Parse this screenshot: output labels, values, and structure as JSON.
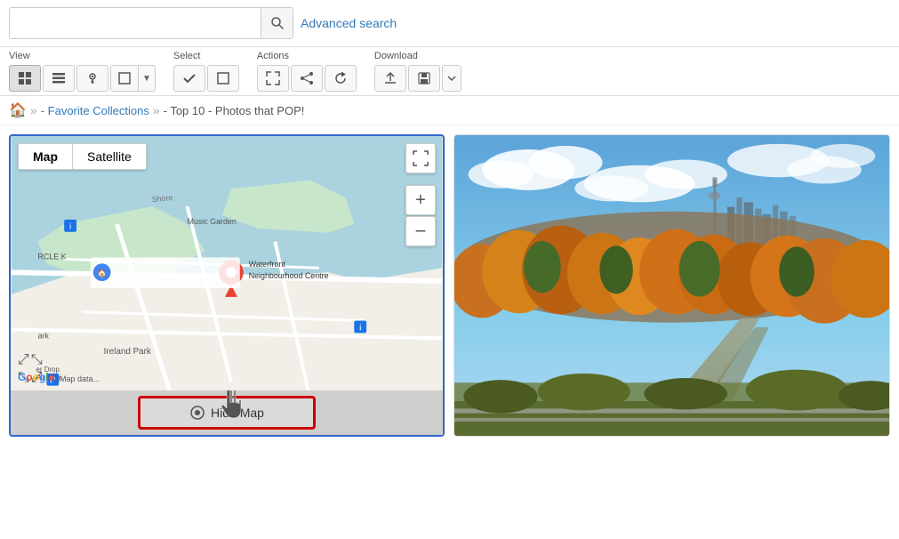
{
  "search": {
    "placeholder": "",
    "value": "",
    "advanced_link": "Advanced search"
  },
  "toolbar": {
    "view_label": "View",
    "select_label": "Select",
    "actions_label": "Actions",
    "download_label": "Download",
    "view_buttons": [
      {
        "id": "grid",
        "icon": "⊞",
        "active": true
      },
      {
        "id": "list",
        "icon": "☰",
        "active": false
      },
      {
        "id": "map",
        "icon": "📍",
        "active": false
      }
    ],
    "select_buttons": [
      {
        "id": "check",
        "icon": "✓",
        "active": false
      },
      {
        "id": "square",
        "icon": "□",
        "active": false
      }
    ],
    "actions_buttons": [
      {
        "id": "expand",
        "icon": "⤢",
        "active": false
      },
      {
        "id": "share",
        "icon": "≺",
        "active": false
      },
      {
        "id": "refresh",
        "icon": "↻",
        "active": false
      }
    ],
    "download_buttons": [
      {
        "id": "upload",
        "icon": "⬆",
        "active": false
      },
      {
        "id": "download",
        "icon": "⬇",
        "active": false
      },
      {
        "id": "more",
        "icon": "▼",
        "active": false
      }
    ]
  },
  "breadcrumb": {
    "home_title": "Home",
    "separator1": "»",
    "collection_link": "- Favorite Collections",
    "separator2": "»",
    "current": "- Top 10 - Photos that POP!"
  },
  "map": {
    "type_map": "Map",
    "type_satellite": "Satellite",
    "hide_map_label": "Hide Map",
    "location_name": "Waterfront Neighbourhood Centre",
    "zoom_plus": "+",
    "zoom_minus": "−"
  },
  "colors": {
    "accent_blue": "#3366cc",
    "link_blue": "#337ab7",
    "red_border": "#cc0000",
    "map_water": "#aad3df",
    "map_land": "#f2efe9",
    "map_green": "#c8e6c9",
    "map_road": "#ffffff"
  }
}
